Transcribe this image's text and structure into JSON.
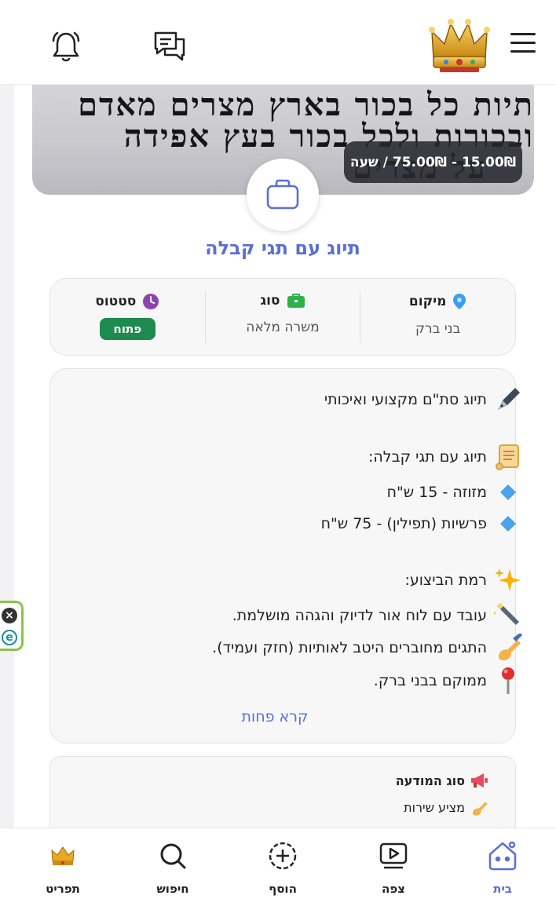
{
  "header": {
    "menu_icon": "hamburger-icon",
    "logo": "crown-logo",
    "chat_icon": "chat-icon",
    "bell_icon": "bell-icon"
  },
  "hero": {
    "script_lines": [
      "תיות כל בכור בארץ מצרים מאדם",
      "ובכורות ולכל בכור בעץ אפידה",
      "על מצרים"
    ],
    "price": "15.00₪ - 75.00₪ / שעה"
  },
  "listing": {
    "title": "תיוג עם תגי קבלה"
  },
  "info": {
    "location_label": "מיקום",
    "location_value": "בני ברק",
    "type_label": "סוג",
    "type_value": "משרה מלאה",
    "status_label": "סטטוס",
    "status_value": "פתוח"
  },
  "description": {
    "lines": [
      {
        "emoji": "✒️",
        "text": "תיוג סת\"ם מקצועי ואיכותי"
      },
      {
        "emoji": "📜",
        "text": "תיוג עם תגי קבלה:"
      },
      {
        "emoji": "🔹",
        "text": "מזוזה - 15 ש\"ח"
      },
      {
        "emoji": "🔹",
        "text": "פרשיות (תפילין) - 75 ש\"ח"
      },
      {
        "emoji": "✨",
        "text": "רמת הביצוע:"
      },
      {
        "emoji": "🔦",
        "text": "עובד עם לוח אור לדיוק והגהה מושלמת."
      },
      {
        "emoji": "✍️",
        "text": "התגים מחוברים היטב לאותיות (חזק ועמיד)."
      },
      {
        "emoji": "📍",
        "text": "ממוקם בבני ברק."
      }
    ],
    "read_less": "קרא פחות"
  },
  "ad_type": {
    "label": "סוג המודעה",
    "value": "מציע שירות"
  },
  "bottom_nav": [
    {
      "label": "בית",
      "icon": "home-icon"
    },
    {
      "label": "צפה",
      "icon": "video-icon"
    },
    {
      "label": "הוסף",
      "icon": "add-icon"
    },
    {
      "label": "חיפוש",
      "icon": "search-icon"
    },
    {
      "label": "תפריט",
      "icon": "crown-icon"
    }
  ],
  "colors": {
    "accent": "#5b6fd6",
    "status_green": "#1d8a4e"
  }
}
